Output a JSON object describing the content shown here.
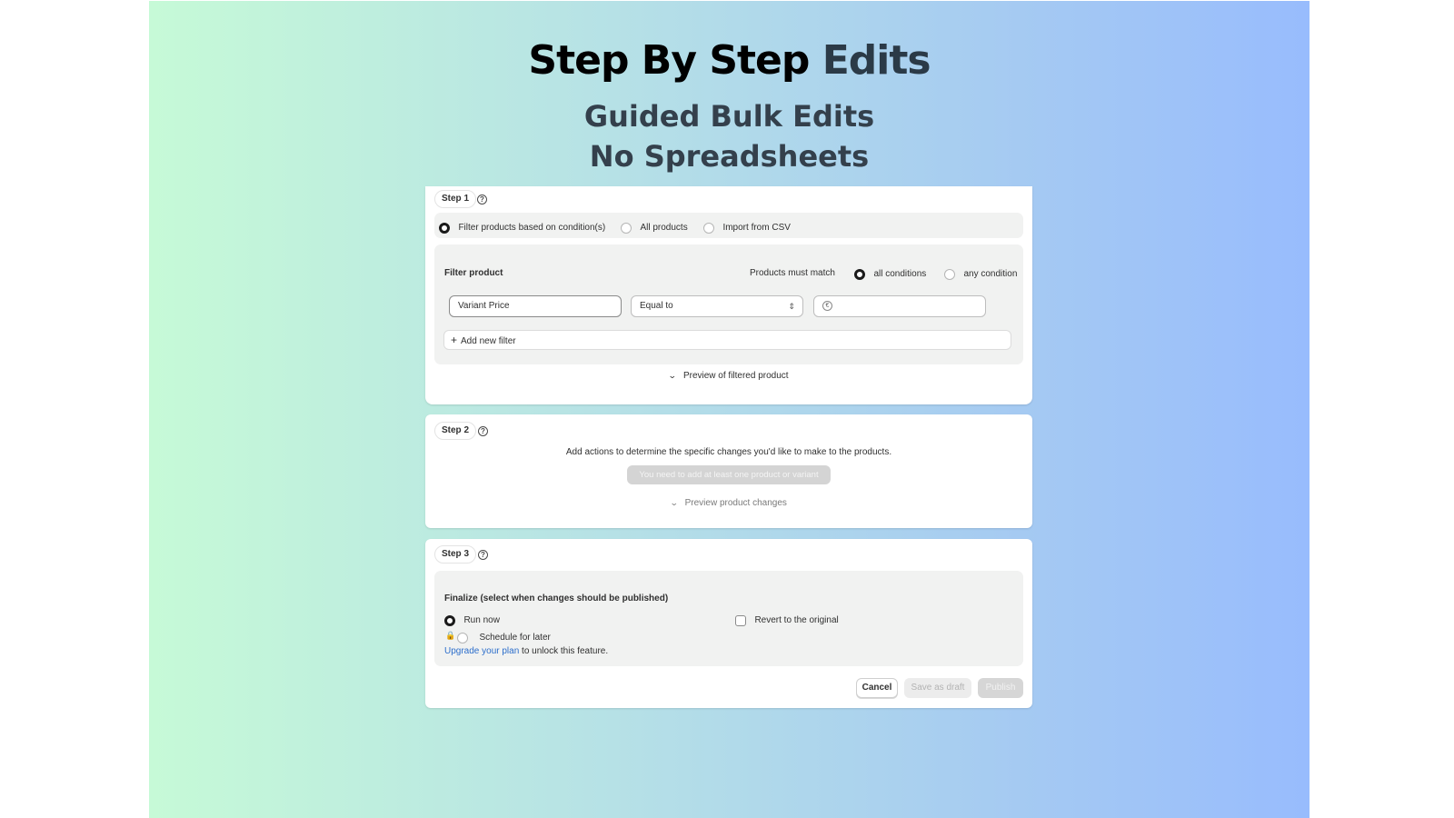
{
  "hero": {
    "title_main": "Step By Step",
    "title_accent": "Edits",
    "subtitle_line1": "Guided Bulk Edits",
    "subtitle_line2": "No Spreadsheets"
  },
  "step1": {
    "badge": "Step 1",
    "options": [
      {
        "label": "Filter products based on condition(s)",
        "selected": true
      },
      {
        "label": "All products",
        "selected": false
      },
      {
        "label": "Import from CSV",
        "selected": false
      }
    ],
    "filter_title": "Filter product",
    "match_label": "Products must match",
    "match_options": [
      {
        "label": "all conditions",
        "selected": true
      },
      {
        "label": "any condition",
        "selected": false
      }
    ],
    "field_value": "Variant Price",
    "operator_value": "Equal to",
    "currency_symbol": "€",
    "amount_value": "",
    "add_filter_label": "Add new filter",
    "preview_label": "Preview of filtered product"
  },
  "step2": {
    "badge": "Step 2",
    "description": "Add actions to determine the specific changes you'd like to make to the products.",
    "disabled_button": "You need to add at least one product or variant",
    "preview_label": "Preview product changes"
  },
  "step3": {
    "badge": "Step 3",
    "finalize_title": "Finalize (select when changes should be published)",
    "run_now": "Run now",
    "schedule_later": "Schedule for later",
    "revert_label": "Revert to the original",
    "upgrade_link": "Upgrade your plan",
    "upgrade_suffix": " to unlock this feature."
  },
  "actions": {
    "cancel": "Cancel",
    "save_draft": "Save as draft",
    "publish": "Publish"
  },
  "icons": {
    "help": "question-circle-icon",
    "plus": "plus-icon",
    "chevron": "chevron-down-icon",
    "lock": "lock-icon",
    "selector": "select-chevrons-icon"
  },
  "colors": {
    "gradient_start": "#c6fad7",
    "gradient_end": "#98bcfd",
    "link": "#2c6ecb"
  }
}
